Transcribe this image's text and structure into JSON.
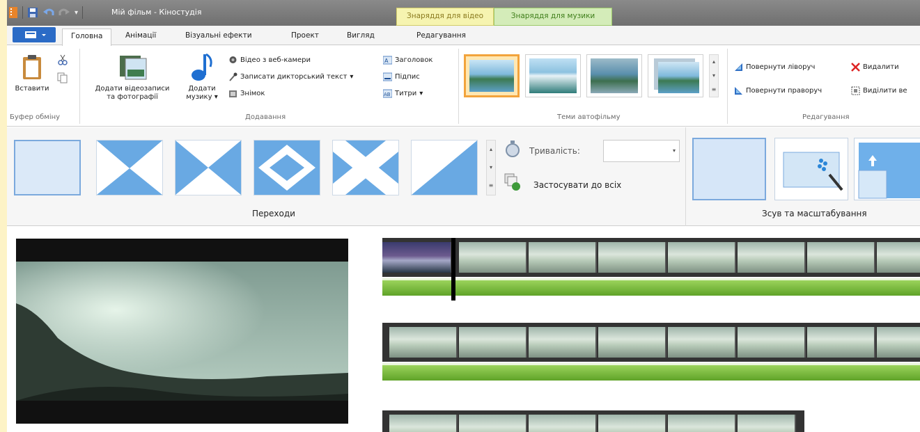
{
  "window": {
    "title": "Мій фільм - Кіностудія",
    "context_tabs": {
      "video_tools": "Знаряддя для відео",
      "music_tools": "Знаряддя для музики"
    }
  },
  "tabs": [
    {
      "label": "Головна",
      "active": true
    },
    {
      "label": "Анімації"
    },
    {
      "label": "Візуальні ефекти"
    },
    {
      "label": "Проект"
    },
    {
      "label": "Вигляд"
    },
    {
      "label": "Редагування"
    }
  ],
  "ribbon": {
    "clipboard": {
      "paste": "Вставити",
      "group": "Буфер обміну"
    },
    "add": {
      "add_videos": [
        "Додати відеозаписи",
        "та фотографії"
      ],
      "add_music": [
        "Додати",
        "музику"
      ],
      "webcam": "Відео з веб-камери",
      "narration": "Записати дикторський текст",
      "snapshot": "Знімок",
      "title": "Заголовок",
      "caption": "Підпис",
      "credits": "Титри",
      "group": "Додавання"
    },
    "themes": {
      "group": "Теми автофільму"
    },
    "editing": {
      "rotate_left": "Повернути ліворуч",
      "rotate_right": "Повернути праворуч",
      "remove": "Видалити",
      "select_all": "Виділити ве",
      "group": "Редагування"
    }
  },
  "transitions": {
    "duration_label": "Тривалість:",
    "duration_value": "",
    "apply_all": "Застосувати до всіх",
    "group": "Переходи"
  },
  "panzoom": {
    "group": "Зсув та масштабування"
  },
  "colors": {
    "accent": "#2b6bc6",
    "video_ctx": "#f6f4b0",
    "music_ctx": "#d4ecb9",
    "audio_green": "#6fb533",
    "selected_theme": "#f2a33c"
  }
}
